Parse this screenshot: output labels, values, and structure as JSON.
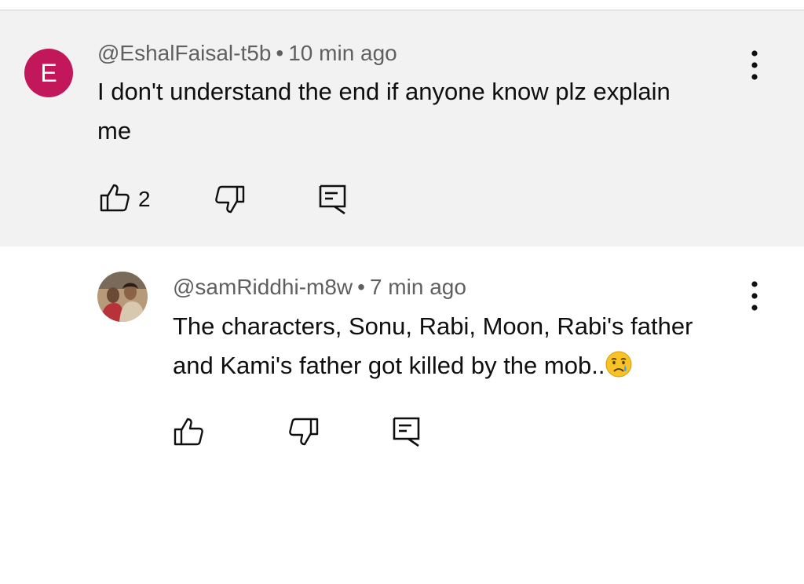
{
  "comments": [
    {
      "avatar_letter": "E",
      "avatar_color": "#c2185b",
      "author": "@EshalFaisal-t5b",
      "separator": "•",
      "time": "10 min ago",
      "text_line1": "I don't understand the end if anyone know plz explain",
      "text_line2": "me",
      "like_count": "2",
      "icons": {
        "like": "thumbs-up-icon",
        "dislike": "thumbs-down-icon",
        "reply": "reply-icon",
        "more": "more-vert-icon"
      },
      "background": "#f2f2f2"
    }
  ],
  "reply": {
    "author": "@samRiddhi-m8w",
    "separator": "•",
    "time": "7 min ago",
    "text_line1": "The characters, Sonu, Rabi, Moon, Rabi's father",
    "text_line2": "and Kami's father got killed by the mob..",
    "emoji": "crying-face-icon",
    "icons": {
      "like": "thumbs-up-icon",
      "dislike": "thumbs-down-icon",
      "reply": "reply-icon",
      "more": "more-vert-icon"
    },
    "background": "#ffffff"
  }
}
